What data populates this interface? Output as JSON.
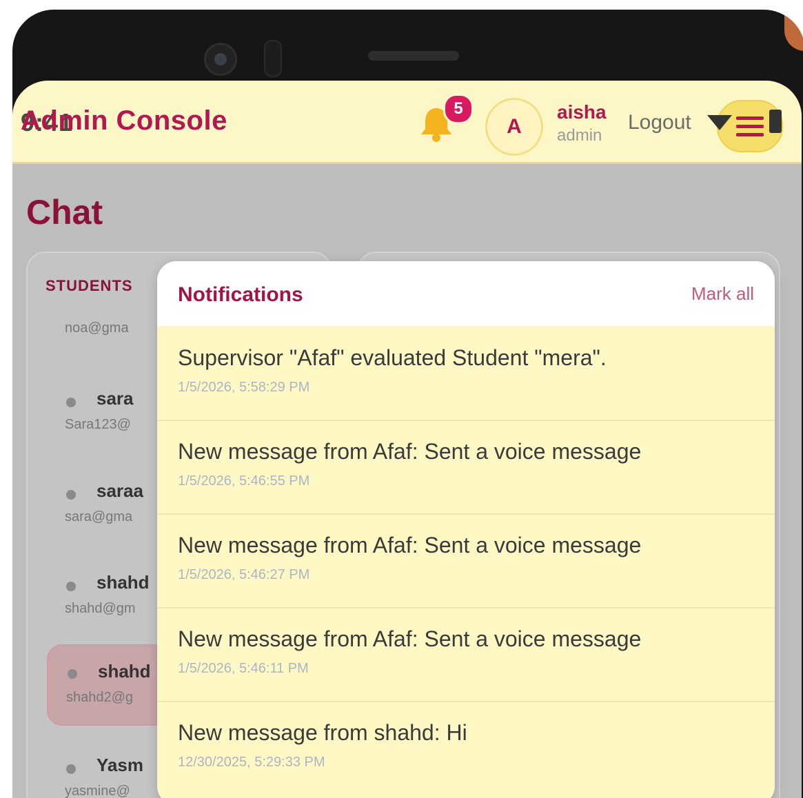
{
  "status_bar": {
    "time": "9:41"
  },
  "header": {
    "title": "Admin Console",
    "notification_count": "5",
    "user_initial": "A",
    "user_name": "aisha",
    "user_role": "admin",
    "logout_label": "Logout"
  },
  "page": {
    "title": "Chat"
  },
  "students_panel": {
    "header": "STUDENTS",
    "items": [
      {
        "name": "",
        "email": "noa@gma"
      },
      {
        "name": "sara",
        "email": "Sara123@"
      },
      {
        "name": "saraa",
        "email": "sara@gma"
      },
      {
        "name": "shahd",
        "email": "shahd@gm"
      },
      {
        "name": "shahd",
        "email": "shahd2@g",
        "selected": true
      },
      {
        "name": "Yasm",
        "email": "yasmine@"
      }
    ]
  },
  "notifications": {
    "title": "Notifications",
    "mark_all_label": "Mark all",
    "items": [
      {
        "message": "Supervisor \"Afaf\" evaluated Student \"mera\".",
        "time": "1/5/2026, 5:58:29 PM"
      },
      {
        "message": "New message from Afaf: Sent a voice message",
        "time": "1/5/2026, 5:46:55 PM"
      },
      {
        "message": "New message from Afaf: Sent a voice message",
        "time": "1/5/2026, 5:46:27 PM"
      },
      {
        "message": "New message from Afaf: Sent a voice message",
        "time": "1/5/2026, 5:46:11 PM"
      },
      {
        "message": "New message from shahd: Hi",
        "time": "12/30/2025, 5:29:33 PM"
      }
    ]
  },
  "colors": {
    "accent": "#b3174f",
    "header_bg": "#fdf6c6",
    "overlay_bg": "#bdbdbd",
    "panel_bg": "#fff8c4",
    "badge": "#d81b60"
  },
  "icons": {
    "bell": "bell-icon",
    "menu": "hamburger-menu-icon",
    "wifi": "wifi-icon",
    "battery": "battery-icon"
  }
}
